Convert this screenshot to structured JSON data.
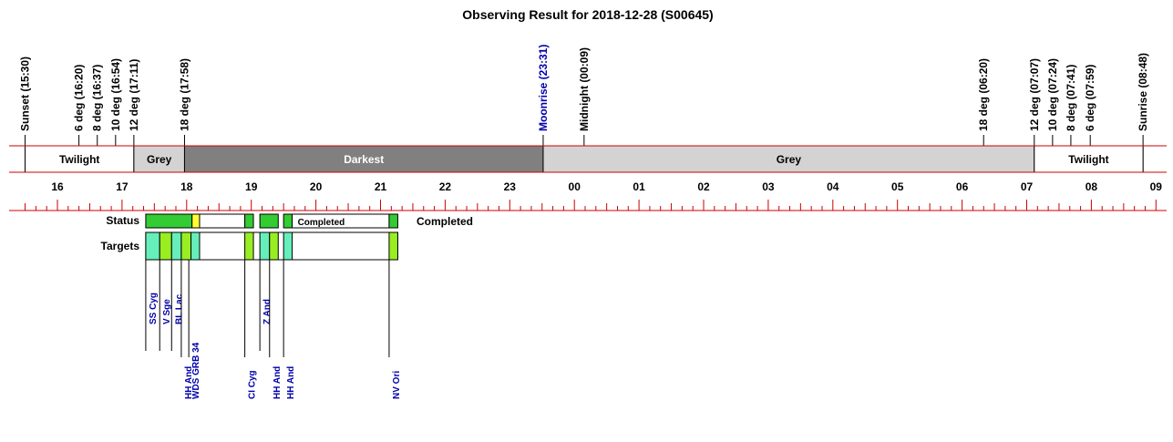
{
  "chart_data": {
    "type": "timeline",
    "title": "Observing Result for 2018-12-28 (S00645)",
    "x_unit": "hour",
    "x_range": [
      15.4,
      33.2
    ],
    "events": [
      {
        "label": "Sunset (15:30)",
        "t": 15.5,
        "color": "#000000"
      },
      {
        "label": "6 deg (16:20)",
        "t": 16.333,
        "color": "#000000"
      },
      {
        "label": "8 deg (16:37)",
        "t": 16.617,
        "color": "#000000"
      },
      {
        "label": "10 deg (16:54)",
        "t": 16.9,
        "color": "#000000"
      },
      {
        "label": "12 deg (17:11)",
        "t": 17.183,
        "color": "#000000"
      },
      {
        "label": "18 deg (17:58)",
        "t": 17.967,
        "color": "#000000"
      },
      {
        "label": "Moonrise (23:31)",
        "t": 23.517,
        "color": "#0000aa"
      },
      {
        "label": "Midnight (00:09)",
        "t": 24.15,
        "color": "#000000"
      },
      {
        "label": "18 deg (06:20)",
        "t": 30.333,
        "color": "#000000"
      },
      {
        "label": "12 deg (07:07)",
        "t": 31.117,
        "color": "#000000"
      },
      {
        "label": "10 deg (07:24)",
        "t": 31.4,
        "color": "#000000"
      },
      {
        "label": "8 deg (07:41)",
        "t": 31.683,
        "color": "#000000"
      },
      {
        "label": "6 deg (07:59)",
        "t": 31.983,
        "color": "#000000"
      },
      {
        "label": "Sunrise (08:48)",
        "t": 32.8,
        "color": "#000000"
      }
    ],
    "periods": [
      {
        "label": "Twilight",
        "start": 15.5,
        "end": 17.183,
        "color": "#ffffff",
        "text_color": "#000000"
      },
      {
        "label": "Grey",
        "start": 17.183,
        "end": 17.967,
        "color": "#d3d3d3",
        "text_color": "#000000"
      },
      {
        "label": "Darkest",
        "start": 17.967,
        "end": 23.517,
        "color": "#808080",
        "text_color": "#ffffff"
      },
      {
        "label": "Grey",
        "start": 23.517,
        "end": 31.117,
        "color": "#d3d3d3",
        "text_color": "#000000"
      },
      {
        "label": "Twilight",
        "start": 31.117,
        "end": 32.8,
        "color": "#ffffff",
        "text_color": "#000000"
      }
    ],
    "ticks": [
      {
        "t": 16,
        "label": "16"
      },
      {
        "t": 17,
        "label": "17"
      },
      {
        "t": 18,
        "label": "18"
      },
      {
        "t": 19,
        "label": "19"
      },
      {
        "t": 20,
        "label": "20"
      },
      {
        "t": 21,
        "label": "21"
      },
      {
        "t": 22,
        "label": "22"
      },
      {
        "t": 23,
        "label": "23"
      },
      {
        "t": 24,
        "label": "00"
      },
      {
        "t": 25,
        "label": "01"
      },
      {
        "t": 26,
        "label": "02"
      },
      {
        "t": 27,
        "label": "03"
      },
      {
        "t": 28,
        "label": "04"
      },
      {
        "t": 29,
        "label": "05"
      },
      {
        "t": 30,
        "label": "06"
      },
      {
        "t": 31,
        "label": "07"
      },
      {
        "t": 32,
        "label": "08"
      },
      {
        "t": 33,
        "label": "09"
      }
    ],
    "status_label": "Status",
    "targets_label": "Targets",
    "status_summary": "Completed",
    "status_segments": [
      {
        "start": 17.367,
        "end": 18.083,
        "color": "#33cc33",
        "text": ""
      },
      {
        "start": 18.083,
        "end": 18.2,
        "color": "#ffff33",
        "text": ""
      },
      {
        "start": 18.2,
        "end": 18.9,
        "color": "#ffffff",
        "text": ""
      },
      {
        "start": 18.9,
        "end": 19.033,
        "color": "#33cc33",
        "text": ""
      },
      {
        "start": 19.133,
        "end": 19.417,
        "color": "#33cc33",
        "text": ""
      },
      {
        "start": 19.5,
        "end": 19.633,
        "color": "#33cc33",
        "text": ""
      },
      {
        "start": 19.633,
        "end": 21.133,
        "color": "#ffffff",
        "text": "Completed"
      },
      {
        "start": 21.133,
        "end": 21.267,
        "color": "#33cc33",
        "text": ""
      }
    ],
    "target_blocks": [
      {
        "start": 17.367,
        "end": 17.583,
        "color": "#66eebb"
      },
      {
        "start": 17.583,
        "end": 17.767,
        "color": "#99ee22"
      },
      {
        "start": 17.767,
        "end": 17.917,
        "color": "#66eebb"
      },
      {
        "start": 17.917,
        "end": 18.067,
        "color": "#99ee22"
      },
      {
        "start": 18.067,
        "end": 18.2,
        "color": "#66eebb"
      },
      {
        "start": 18.9,
        "end": 19.033,
        "color": "#99ee22"
      },
      {
        "start": 19.133,
        "end": 19.283,
        "color": "#66eebb"
      },
      {
        "start": 19.283,
        "end": 19.417,
        "color": "#99ee22"
      },
      {
        "start": 19.5,
        "end": 19.633,
        "color": "#66eebb"
      },
      {
        "start": 21.133,
        "end": 21.267,
        "color": "#99ee22"
      }
    ],
    "targets": [
      {
        "name": "SS Cyg",
        "t": 17.367,
        "row": "upper"
      },
      {
        "name": "V Sge",
        "t": 17.583,
        "row": "upper"
      },
      {
        "name": "BL Lac",
        "t": 17.767,
        "row": "upper"
      },
      {
        "name": "HH And",
        "t": 17.917,
        "row": "lower"
      },
      {
        "name": "WDS GRB 34",
        "t": 18.033,
        "row": "lower"
      },
      {
        "name": "CI Cyg",
        "t": 18.9,
        "row": "lower"
      },
      {
        "name": "Z And",
        "t": 19.133,
        "row": "upper"
      },
      {
        "name": "HH And",
        "t": 19.283,
        "row": "lower"
      },
      {
        "name": "HH And",
        "t": 19.5,
        "row": "lower"
      },
      {
        "name": "NV Ori",
        "t": 21.133,
        "row": "lower"
      }
    ],
    "colors": {
      "axis": "#cc0000",
      "target_text": "#0000aa"
    }
  }
}
